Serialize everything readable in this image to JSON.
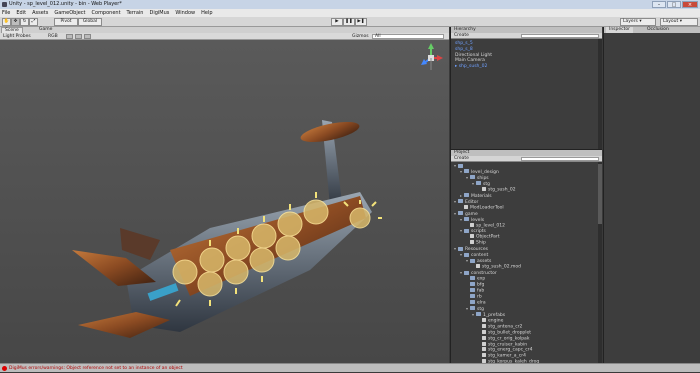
{
  "window": {
    "title": "Unity - sp_level_012.unity - bin - Web Player*"
  },
  "menu": [
    "File",
    "Edit",
    "Assets",
    "GameObject",
    "Component",
    "Terrain",
    "DigiMus",
    "Window",
    "Help"
  ],
  "toolbar": {
    "pivot": "Pivot",
    "global": "Global",
    "layers": "Layers",
    "layout": "Layout"
  },
  "scene": {
    "tabs": [
      "Scene",
      "Game"
    ],
    "render_mode": "Light Probes",
    "draw_mode": "RGB",
    "gizmos": "Gizmos",
    "search": "All"
  },
  "hierarchy": {
    "title": "Hierarchy",
    "create": "Create",
    "search": "All",
    "items": [
      {
        "label": "shp_s_5",
        "selected": true,
        "indent": 0,
        "arrow": ""
      },
      {
        "label": "shp_s_8",
        "selected": true,
        "indent": 0,
        "arrow": ""
      },
      {
        "label": "Directional Light",
        "selected": false,
        "indent": 0,
        "arrow": ""
      },
      {
        "label": "Main Camera",
        "selected": false,
        "indent": 0,
        "arrow": ""
      },
      {
        "label": "shp_sush_02",
        "selected": true,
        "indent": 0,
        "arrow": "▸"
      }
    ]
  },
  "project": {
    "title": "Project",
    "create": "Create",
    "search": "All",
    "items": [
      {
        "label": "",
        "indent": 0,
        "kind": "folder",
        "arrow": "▾"
      },
      {
        "label": "level_design",
        "indent": 1,
        "kind": "folder",
        "arrow": "▾"
      },
      {
        "label": "ships",
        "indent": 2,
        "kind": "folder",
        "arrow": "▾"
      },
      {
        "label": "stg",
        "indent": 3,
        "kind": "folder",
        "arrow": "▾"
      },
      {
        "label": "stg_sush_02",
        "indent": 4,
        "kind": "file",
        "arrow": ""
      },
      {
        "label": "Materials",
        "indent": 1,
        "kind": "folder",
        "arrow": "▸"
      },
      {
        "label": "Editor",
        "indent": 0,
        "kind": "folder",
        "arrow": "▾"
      },
      {
        "label": "ModLoaderTool",
        "indent": 1,
        "kind": "file",
        "arrow": ""
      },
      {
        "label": "game",
        "indent": 0,
        "kind": "folder",
        "arrow": "▾"
      },
      {
        "label": "levels",
        "indent": 1,
        "kind": "folder",
        "arrow": "▾"
      },
      {
        "label": "sp_level_012",
        "indent": 2,
        "kind": "file",
        "arrow": ""
      },
      {
        "label": "scripts",
        "indent": 1,
        "kind": "folder",
        "arrow": "▾"
      },
      {
        "label": "ObjectPart",
        "indent": 2,
        "kind": "file",
        "arrow": ""
      },
      {
        "label": "Ship",
        "indent": 2,
        "kind": "file",
        "arrow": ""
      },
      {
        "label": "Resources",
        "indent": 0,
        "kind": "folder",
        "arrow": "▾"
      },
      {
        "label": "content",
        "indent": 1,
        "kind": "folder",
        "arrow": "▾"
      },
      {
        "label": "assets",
        "indent": 2,
        "kind": "folder",
        "arrow": "▾"
      },
      {
        "label": "stg_sush_02.mod",
        "indent": 3,
        "kind": "file",
        "arrow": ""
      },
      {
        "label": "constructor",
        "indent": 1,
        "kind": "folder",
        "arrow": "▾"
      },
      {
        "label": "exp",
        "indent": 2,
        "kind": "folder",
        "arrow": ""
      },
      {
        "label": "bfg",
        "indent": 2,
        "kind": "folder",
        "arrow": ""
      },
      {
        "label": "fab",
        "indent": 2,
        "kind": "folder",
        "arrow": ""
      },
      {
        "label": "rb",
        "indent": 2,
        "kind": "folder",
        "arrow": ""
      },
      {
        "label": "elra",
        "indent": 2,
        "kind": "folder",
        "arrow": ""
      },
      {
        "label": "stg",
        "indent": 2,
        "kind": "folder",
        "arrow": "▾"
      },
      {
        "label": "1_prefabs",
        "indent": 3,
        "kind": "folder",
        "arrow": "▾"
      },
      {
        "label": "engine",
        "indent": 4,
        "kind": "file",
        "arrow": ""
      },
      {
        "label": "stg_antena_cr2",
        "indent": 4,
        "kind": "file",
        "arrow": ""
      },
      {
        "label": "stg_bullet_dropplet",
        "indent": 4,
        "kind": "file",
        "arrow": ""
      },
      {
        "label": "stg_cr_orig_kolpak",
        "indent": 4,
        "kind": "file",
        "arrow": ""
      },
      {
        "label": "stg_cruiser_kabin",
        "indent": 4,
        "kind": "file",
        "arrow": ""
      },
      {
        "label": "stg_energ_capc_cr4",
        "indent": 4,
        "kind": "file",
        "arrow": ""
      },
      {
        "label": "stg_kamer_a_cr4",
        "indent": 4,
        "kind": "file",
        "arrow": ""
      },
      {
        "label": "stg_korpus_kaleh_drog",
        "indent": 4,
        "kind": "file",
        "arrow": ""
      }
    ]
  },
  "inspector": {
    "tabs": [
      "Inspector",
      "Occlusion"
    ]
  },
  "status": {
    "message": "DigiMus errors/warnings: Object reference not set to an instance of an object"
  }
}
